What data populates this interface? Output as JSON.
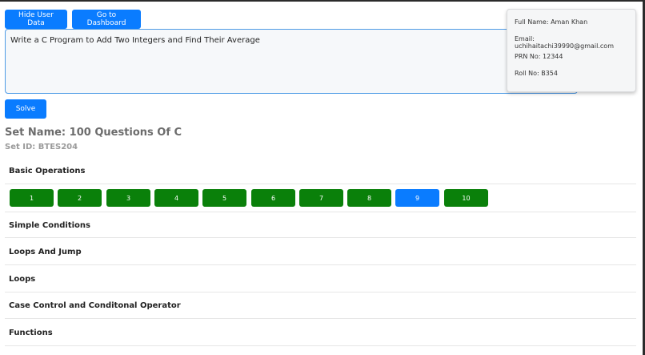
{
  "toolbar": {
    "hide_user_data": "Hide User Data",
    "go_to_dashboard": "Go to Dashboard"
  },
  "question": {
    "text": "Write a C Program to Add Two Integers and Find Their Average"
  },
  "solve_label": "Solve",
  "user": {
    "full_name": "Full Name: Aman Khan",
    "email": "Email: uchihaitachi39990@gmail.com",
    "prn": "PRN No: 12344",
    "roll": "Roll No: B354"
  },
  "set": {
    "name": "Set Name: 100 Questions Of C",
    "id": "Set ID: BTES204"
  },
  "sections": [
    {
      "title": "Basic Operations"
    },
    {
      "title": "Simple Conditions"
    },
    {
      "title": "Loops And Jump"
    },
    {
      "title": "Loops"
    },
    {
      "title": "Case Control and Conditonal Operator"
    },
    {
      "title": "Functions"
    }
  ],
  "questions": [
    {
      "label": "1",
      "status": "solved"
    },
    {
      "label": "2",
      "status": "solved"
    },
    {
      "label": "3",
      "status": "solved"
    },
    {
      "label": "4",
      "status": "solved"
    },
    {
      "label": "5",
      "status": "solved"
    },
    {
      "label": "6",
      "status": "solved"
    },
    {
      "label": "7",
      "status": "solved"
    },
    {
      "label": "8",
      "status": "solved"
    },
    {
      "label": "9",
      "status": "active"
    },
    {
      "label": "10",
      "status": "solved"
    }
  ],
  "colors": {
    "primary": "#0a7cff",
    "solved": "#0a800a"
  }
}
